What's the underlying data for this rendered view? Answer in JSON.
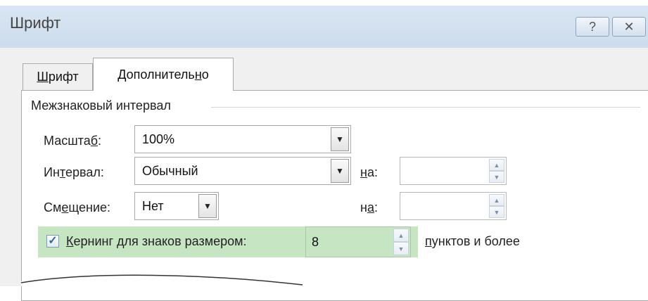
{
  "window": {
    "title": "Шрифт",
    "help_glyph": "?",
    "close_glyph": "✕"
  },
  "tabs": [
    {
      "label_prefix": "",
      "label_accel": "Ш",
      "label_rest": "рифт"
    },
    {
      "label_prefix": "Дополнитель",
      "label_accel": "н",
      "label_rest": "о"
    }
  ],
  "spacing_group": {
    "title": "Межзнаковый интервал",
    "scale": {
      "label_prefix": "Масшта",
      "label_accel": "б",
      "label_rest": ":",
      "value": "100%"
    },
    "spacing": {
      "label_prefix": "Ин",
      "label_accel": "т",
      "label_rest": "ервал:",
      "value": "Обычный",
      "by_accel": "н",
      "by_rest": "а:",
      "by_value": ""
    },
    "position": {
      "label_prefix": "См",
      "label_accel": "е",
      "label_rest": "щение:",
      "value": "Нет",
      "by_prefix": "н",
      "by_accel": "а",
      "by_rest": ":",
      "by_value": ""
    },
    "kerning": {
      "checked": true,
      "check_glyph": "✓",
      "label_accel": "К",
      "label_rest": "ернинг для знаков размером:",
      "value": "8",
      "suffix_accel": "п",
      "suffix_rest": "унктов и более"
    }
  },
  "glyphs": {
    "dropdown": "▼",
    "spin_up": "▲",
    "spin_down": "▼"
  }
}
